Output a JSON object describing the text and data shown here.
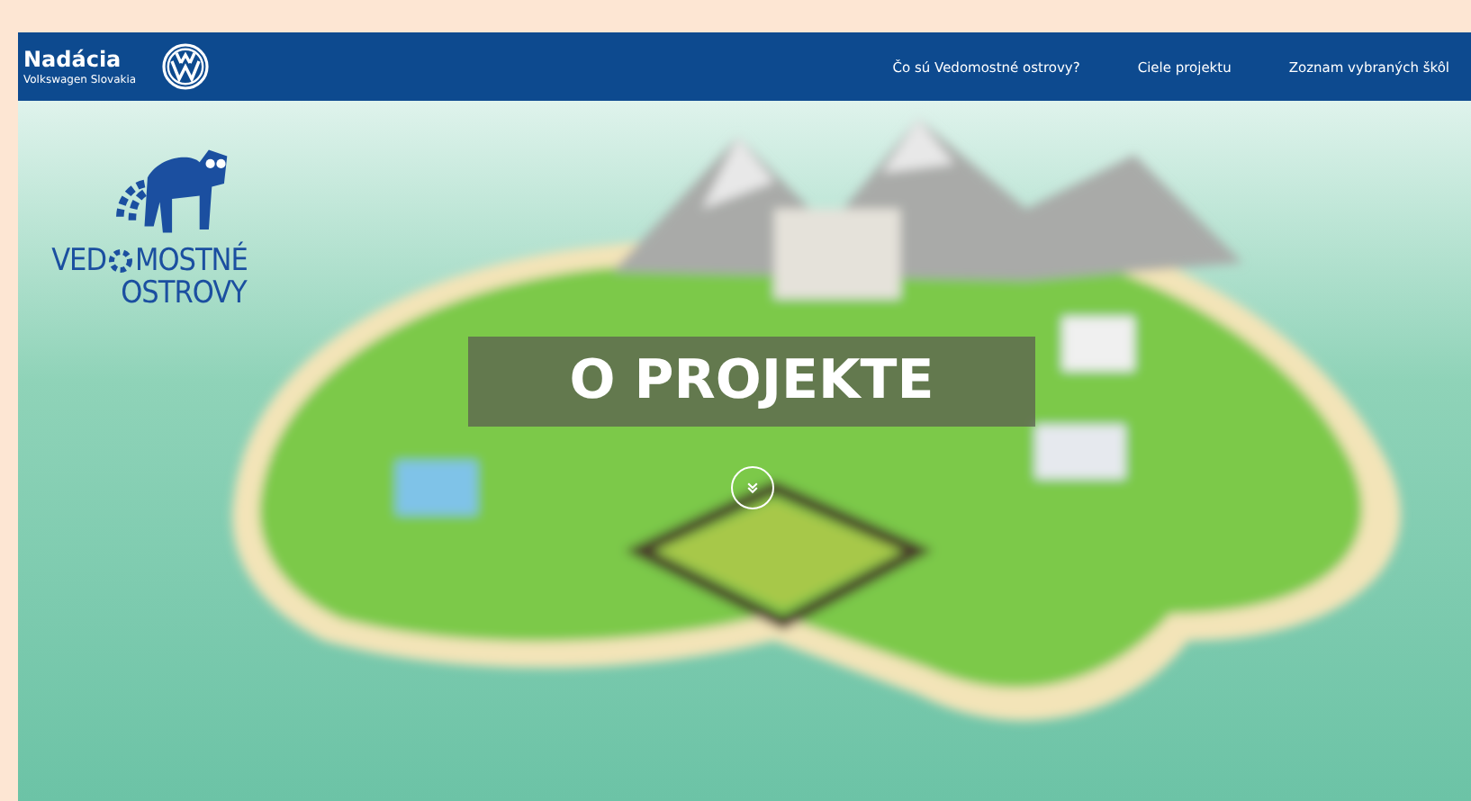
{
  "header": {
    "brand": {
      "name": "Nadácia",
      "subtitle": "Volkswagen Slovakia"
    },
    "nav": [
      {
        "label": "Čo sú Vedomostné ostrovy?"
      },
      {
        "label": "Ciele projektu"
      },
      {
        "label": "Zoznam vybraných škôl"
      }
    ]
  },
  "logo": {
    "line_1_start": "VED",
    "line_1_end": "MOSTNÉ",
    "line_2": "OSTROVY"
  },
  "hero": {
    "title": "O PROJEKTE"
  }
}
